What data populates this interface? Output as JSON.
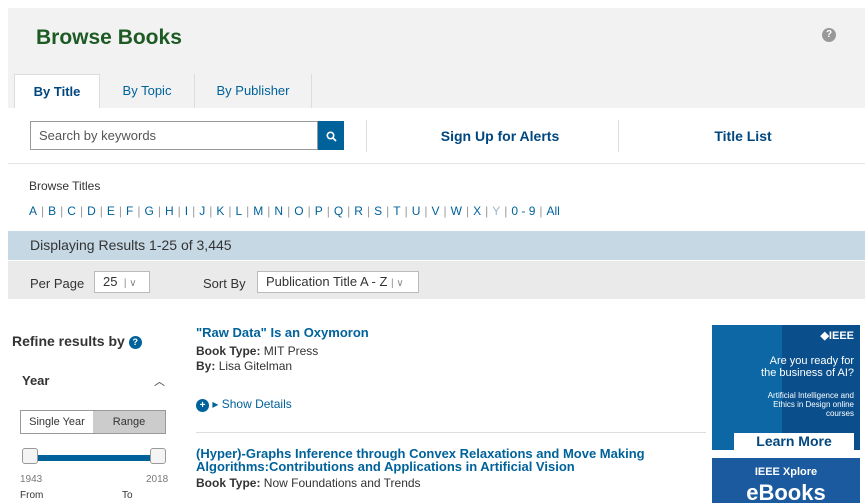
{
  "header": {
    "title": "Browse Books",
    "help_icon": "?"
  },
  "tabs": [
    {
      "label": "By Title",
      "active": true
    },
    {
      "label": "By Topic",
      "active": false
    },
    {
      "label": "By Publisher",
      "active": false
    }
  ],
  "toolbar": {
    "search_placeholder": "Search by keywords",
    "alerts_label": "Sign Up for Alerts",
    "title_list_label": "Title List"
  },
  "browse": {
    "label": "Browse Titles",
    "letters": [
      "A",
      "B",
      "C",
      "D",
      "E",
      "F",
      "G",
      "H",
      "I",
      "J",
      "K",
      "L",
      "M",
      "N",
      "O",
      "P",
      "Q",
      "R",
      "S",
      "T",
      "U",
      "V",
      "W",
      "X",
      "Y",
      "0 - 9",
      "All"
    ],
    "disabled_letters": [
      "Y"
    ]
  },
  "results": {
    "summary": "Displaying Results 1-25 of 3,445"
  },
  "controls": {
    "per_page_label": "Per Page",
    "per_page_value": "25",
    "sort_by_label": "Sort By",
    "sort_by_value": "Publication Title A - Z"
  },
  "refine": {
    "title": "Refine results by",
    "year_label": "Year",
    "single_year_label": "Single Year",
    "range_label": "Range",
    "min_year": "1943",
    "max_year": "2018",
    "from_label": "From",
    "to_label": "To"
  },
  "items": [
    {
      "title": "\"Raw Data\" Is an Oxymoron",
      "type_label": "Book Type:",
      "type_value": "MIT Press",
      "by_label": "By:",
      "by_value": "Lisa Gitelman",
      "show_details": "Show Details"
    },
    {
      "title_line1": "(Hyper)-Graphs Inference through Convex Relaxations and Move Making",
      "title_line2": "Algorithms:Contributions and Applications in Artificial Vision",
      "type_label": "Book Type:",
      "type_value": "Now Foundations and Trends"
    }
  ],
  "ads": {
    "ad1": {
      "brand": "IEEE",
      "headline": "Are you ready for the business of AI?",
      "sub": "Artificial Intelligence and Ethics in Design online courses",
      "cta": "Learn More"
    },
    "ad2": {
      "small": "IEEE Xplore",
      "big": "eBooks"
    }
  },
  "colors": {
    "title_green": "#1e5a24",
    "link_blue": "#00629b",
    "results_band": "#c5d8e4"
  }
}
